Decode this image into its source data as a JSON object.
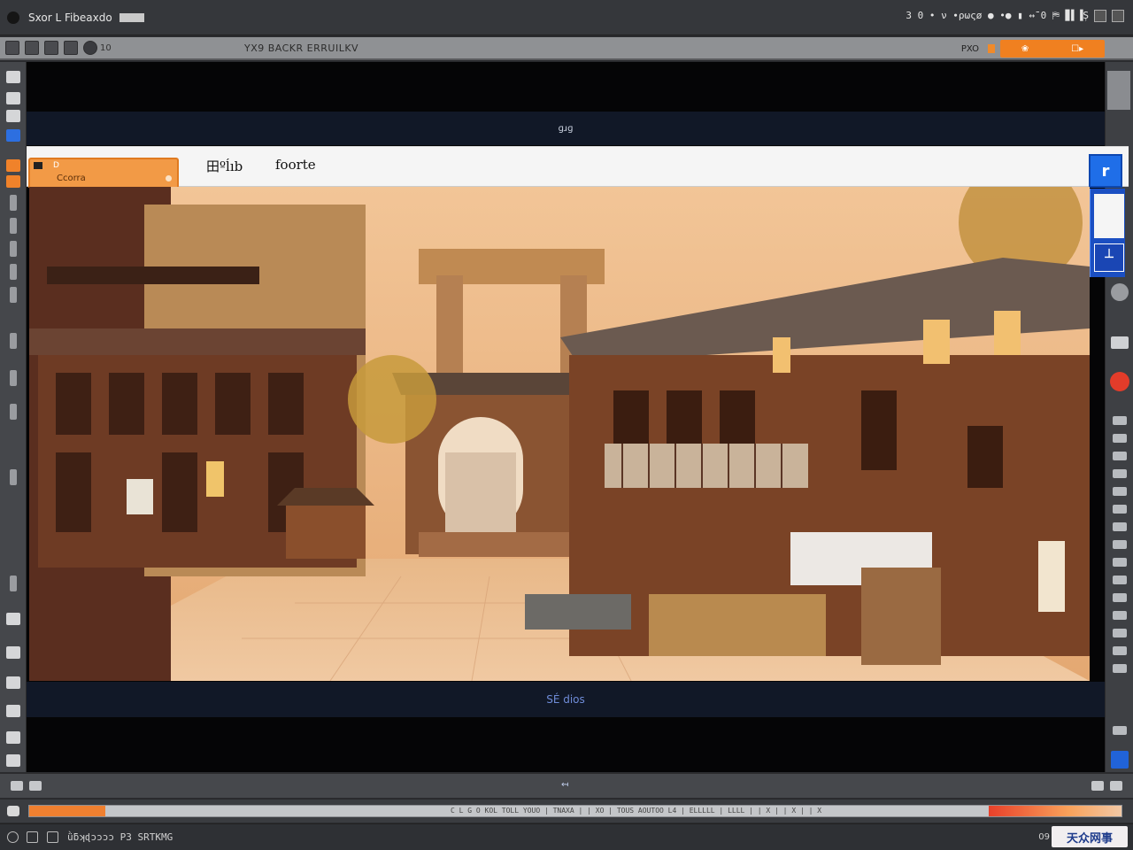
{
  "window": {
    "title": "Sxor L Fibeaxdo",
    "status_text": "3 0 • ν ∙ρωςø ● •● ▮ ↔̄̄ 0 ⛿ ▊▌▐̹S"
  },
  "toolbar": {
    "number": "10",
    "document_title": "YX9 BACKR ERRUILKV",
    "right_label": "PXO",
    "orange_tab": {
      "left": "❀",
      "right": "☐▸"
    }
  },
  "canvas": {
    "top_label": "ɡɹɡ",
    "bottom_label": "SÉ dios"
  },
  "doc_header": {
    "panel_top": "D",
    "panel_label": "Ccorra",
    "tab_one": "田ºĺıb",
    "tab_two": "foorte",
    "blue_button": "r",
    "side_button": "┴"
  },
  "status_row": {
    "center": "↤̴"
  },
  "timeline": {
    "progress": 0.07,
    "track_text": "C L G O KOL TOLL  YOUO  | TNAXA | | XO | TOUS   AOUTOO                        L4  | ELLLLL | LLLL  | | X |  | X |  | X"
  },
  "bottom": {
    "code_text": "ǜƃʞɖɔɔɔɔ P3 SRTKMG",
    "right_text": "09",
    "badge": "天众网事"
  },
  "colors": {
    "accent_orange": "#f08020",
    "accent_blue": "#1f6ee8",
    "stage_black": "#050506"
  },
  "icons": {
    "left_tools": [
      "brush-icon",
      "eraser-icon",
      "lasso-icon",
      "zoom-icon",
      "text-icon"
    ],
    "right_tools": [
      "layers-icon",
      "settings-icon",
      "record-icon",
      "history-icon"
    ]
  }
}
